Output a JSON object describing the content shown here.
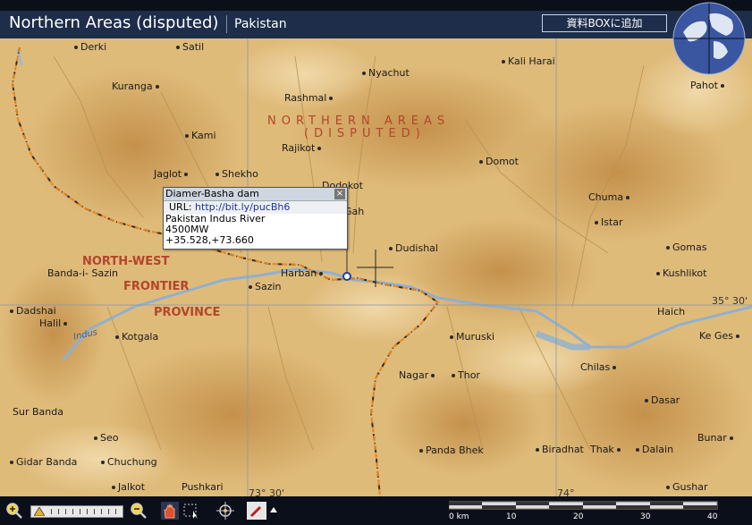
{
  "header": {
    "title": "Northern Areas (disputed)",
    "country": "Pakistan",
    "box_button": "資料BOXに追加"
  },
  "popup": {
    "title": "Diamer-Basha dam",
    "close_label": "×",
    "url_label": "URL:",
    "url": "http://bit.ly/pucBh6",
    "lines": [
      "Pakistan Indus River",
      "4500MW",
      "+35.528,+73.660"
    ]
  },
  "regions": {
    "northern_areas_1": "NORTHERN AREAS",
    "northern_areas_2": "(DISPUTED)",
    "nwfp_1": "NORTH-WEST",
    "nwfp_2": "FRONTIER",
    "nwfp_3": "PROVINCE"
  },
  "river_label": "Indus",
  "coords": {
    "lat_35_30": "35° 30'",
    "lon_73_30": "73° 30'",
    "lon_74": "74°"
  },
  "places": [
    "Derki",
    "Satil",
    "Kuranga",
    "Nyachut",
    "Kali Harai",
    "Pahot",
    "Rashmal",
    "Kami",
    "Rajikot",
    "Domot",
    "Jaglot",
    "Shekho",
    "Dodokot",
    "Chuma",
    "Gah",
    "Istar",
    "Dudishal",
    "Gomas",
    "Banda-i- Sazin",
    "Kushlikot",
    "Harban",
    "Sazin",
    "Dadshai",
    "Haich",
    "Halil",
    "Kotgala",
    "Muruski",
    "Ke Ges",
    "Chilas",
    "Nagar",
    "Thor",
    "Dasar",
    "Sur Banda",
    "Seo",
    "Bunar",
    "Panda Bhek",
    "Biradhat",
    "Thak",
    "Dalain",
    "Gidar Banda",
    "Chuchung",
    "Jalkot",
    "Pushkari",
    "Gushar"
  ],
  "toolbar": {
    "scale_labels": [
      "0 km",
      "10",
      "20",
      "30",
      "40"
    ]
  },
  "colors": {
    "header_bg": "#1d2d4a",
    "terrain_light": "#e6c991",
    "terrain_dark": "#c99a52",
    "region_label": "#b3452b",
    "border_line": "#e07d1a",
    "river": "#8fb0d0"
  }
}
